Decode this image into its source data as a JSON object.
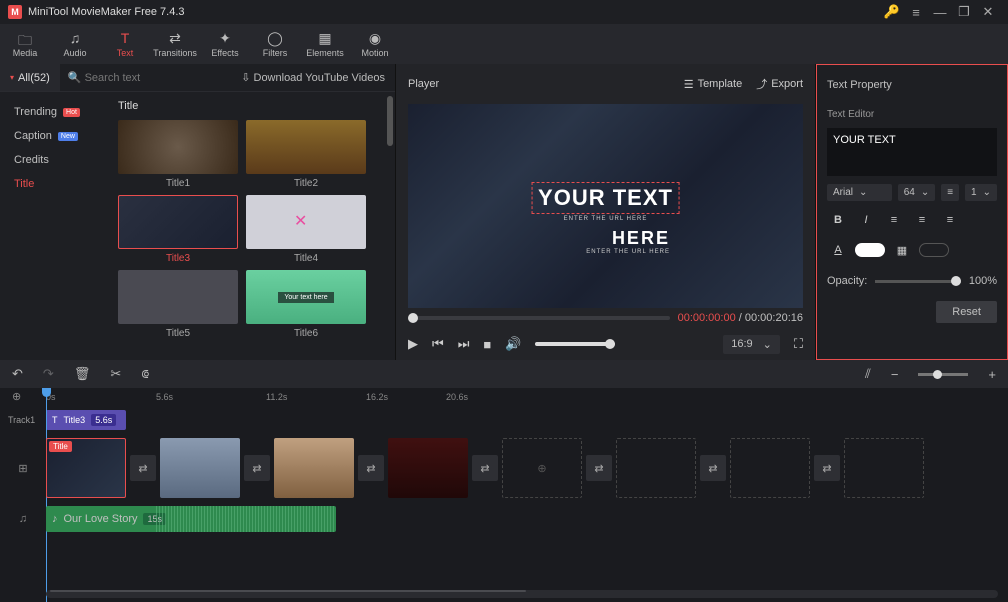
{
  "titlebar": {
    "app_title": "MiniTool MovieMaker Free 7.4.3"
  },
  "toolbar": {
    "tabs": [
      {
        "label": "Media"
      },
      {
        "label": "Audio"
      },
      {
        "label": "Text"
      },
      {
        "label": "Transitions"
      },
      {
        "label": "Effects"
      },
      {
        "label": "Filters"
      },
      {
        "label": "Elements"
      },
      {
        "label": "Motion"
      }
    ]
  },
  "left": {
    "all_label": "All(52)",
    "search_placeholder": "Search text",
    "download_label": "Download YouTube Videos",
    "categories": [
      {
        "label": "Trending",
        "badge": "Hot"
      },
      {
        "label": "Caption",
        "badge": "New"
      },
      {
        "label": "Credits"
      },
      {
        "label": "Title",
        "active": true
      }
    ],
    "section_title": "Title",
    "thumbs": [
      {
        "label": "Title1"
      },
      {
        "label": "Title2"
      },
      {
        "label": "Title3",
        "selected": true
      },
      {
        "label": "Title4"
      },
      {
        "label": "Title5"
      },
      {
        "label": "Title6"
      }
    ]
  },
  "player": {
    "title": "Player",
    "template_label": "Template",
    "export_label": "Export",
    "preview_text_main": "YOUR TEXT",
    "preview_text_sub": "ENTER THE URL HERE",
    "preview_text_here": "HERE",
    "preview_text_here_sub": "ENTER THE URL HERE",
    "time_current": "00:00:00:00",
    "time_total": "00:00:20:16",
    "aspect_ratio": "16:9"
  },
  "text_property": {
    "title": "Text Property",
    "editor_label": "Text Editor",
    "text_value": "YOUR TEXT",
    "font": "Arial",
    "size": "64",
    "spacing": "1",
    "opacity_label": "Opacity:",
    "opacity_value": "100%",
    "reset_label": "Reset"
  },
  "timeline": {
    "ticks": [
      "0s",
      "5.6s",
      "11.2s",
      "16.2s",
      "20.6s"
    ],
    "track1_label": "Track1",
    "title_clip": {
      "name": "Title3",
      "duration": "5.6s"
    },
    "video_clip_tag": "Title",
    "audio_clip": {
      "name": "Our Love Story",
      "duration": "15s"
    }
  }
}
